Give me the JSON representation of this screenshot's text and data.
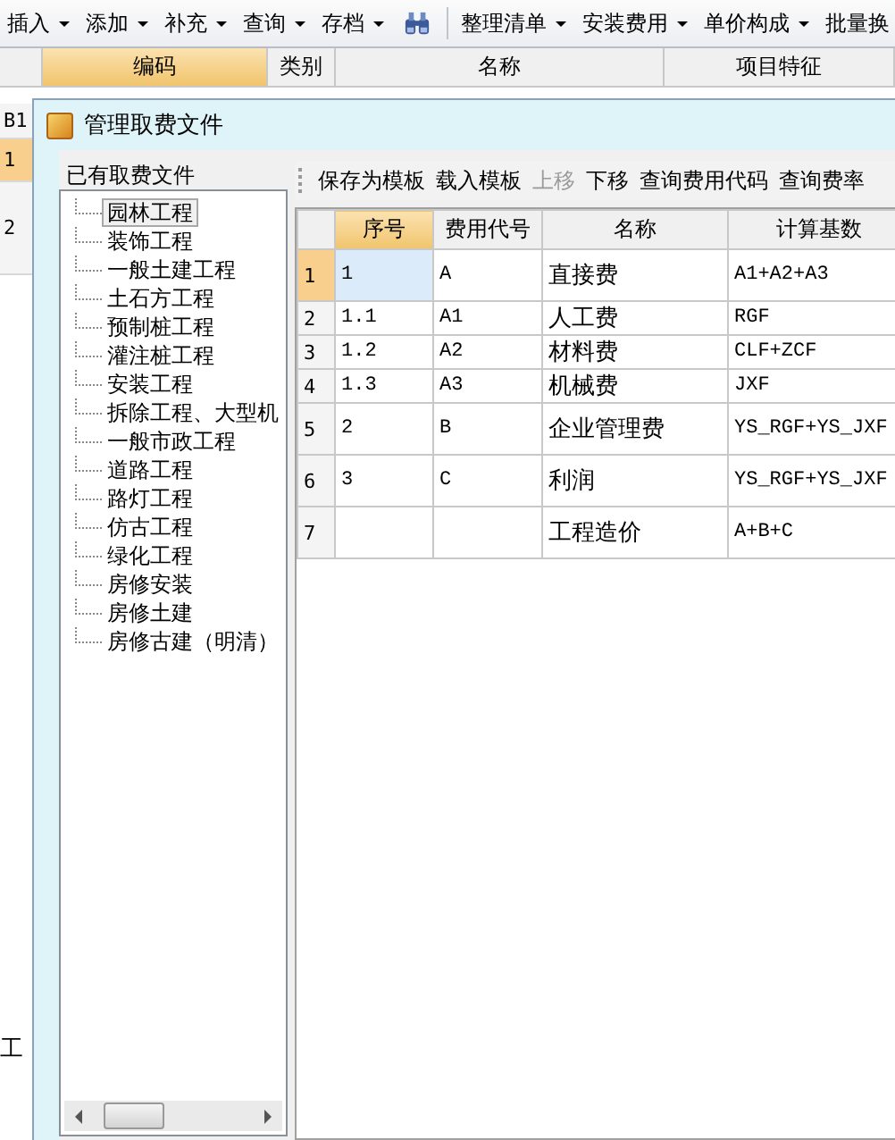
{
  "toolbar": [
    {
      "kind": "menu",
      "label": "插入"
    },
    {
      "kind": "menu",
      "label": "添加"
    },
    {
      "kind": "menu",
      "label": "补充"
    },
    {
      "kind": "menu",
      "label": "查询"
    },
    {
      "kind": "menu",
      "label": "存档"
    },
    {
      "kind": "icon"
    },
    {
      "kind": "separator"
    },
    {
      "kind": "menu",
      "label": "整理清单"
    },
    {
      "kind": "menu",
      "label": "安装费用"
    },
    {
      "kind": "menu",
      "label": "单价构成"
    },
    {
      "kind": "menu",
      "label": "批量换"
    }
  ],
  "grid": {
    "columns": [
      {
        "selected": false
      },
      {
        "label": "编码",
        "selected": true
      },
      {
        "label": "类别",
        "selected": false
      },
      {
        "label": "名称",
        "selected": false
      },
      {
        "label": "项目特征",
        "selected": false
      }
    ],
    "row_headers": [
      {
        "label": "B1",
        "selected": false
      },
      {
        "label": "1",
        "selected": true
      },
      {
        "label": "2",
        "selected": false
      }
    ],
    "bottom_tab": "工"
  },
  "dialog": {
    "title": "管理取费文件",
    "files_label": "已有取费文件",
    "files": [
      {
        "label": "园林工程",
        "selected": true
      },
      {
        "label": "装饰工程",
        "selected": false
      },
      {
        "label": "一般土建工程",
        "selected": false
      },
      {
        "label": "土石方工程",
        "selected": false
      },
      {
        "label": "预制桩工程",
        "selected": false
      },
      {
        "label": "灌注桩工程",
        "selected": false
      },
      {
        "label": "安装工程",
        "selected": false
      },
      {
        "label": "拆除工程、大型机",
        "selected": false
      },
      {
        "label": "一般市政工程",
        "selected": false
      },
      {
        "label": "道路工程",
        "selected": false
      },
      {
        "label": "路灯工程",
        "selected": false
      },
      {
        "label": "仿古工程",
        "selected": false
      },
      {
        "label": "绿化工程",
        "selected": false
      },
      {
        "label": "房修安装",
        "selected": false
      },
      {
        "label": "房修土建",
        "selected": false
      },
      {
        "label": "房修古建（明清）",
        "selected": false
      }
    ],
    "actions": [
      {
        "label": "保存为模板",
        "disabled": false
      },
      {
        "label": "载入模板",
        "disabled": false
      },
      {
        "label": "上移",
        "disabled": true
      },
      {
        "label": "下移",
        "disabled": false
      },
      {
        "label": "查询费用代码",
        "disabled": false
      },
      {
        "label": "查询费率",
        "disabled": false
      }
    ],
    "table": {
      "columns": [
        {
          "label": "序号",
          "selected": true
        },
        {
          "label": "费用代号",
          "selected": false
        },
        {
          "label": "名称",
          "selected": false
        },
        {
          "label": "计算基数",
          "selected": false
        }
      ],
      "rows": [
        {
          "num": "1",
          "selected": true,
          "cells": [
            "1",
            "A",
            "直接费",
            "A1+A2+A3"
          ]
        },
        {
          "num": "2",
          "selected": false,
          "cells": [
            "1.1",
            "A1",
            "人工费",
            "RGF"
          ]
        },
        {
          "num": "3",
          "selected": false,
          "cells": [
            "1.2",
            "A2",
            "材料费",
            "CLF+ZCF"
          ]
        },
        {
          "num": "4",
          "selected": false,
          "cells": [
            "1.3",
            "A3",
            "机械费",
            "JXF"
          ]
        },
        {
          "num": "5",
          "selected": false,
          "cells": [
            "2",
            "B",
            "企业管理费",
            "YS_RGF+YS_JXF"
          ]
        },
        {
          "num": "6",
          "selected": false,
          "cells": [
            "3",
            "C",
            "利润",
            "YS_RGF+YS_JXF"
          ]
        },
        {
          "num": "7",
          "selected": false,
          "cells": [
            "",
            "",
            "工程造价",
            "A+B+C"
          ]
        }
      ]
    }
  }
}
